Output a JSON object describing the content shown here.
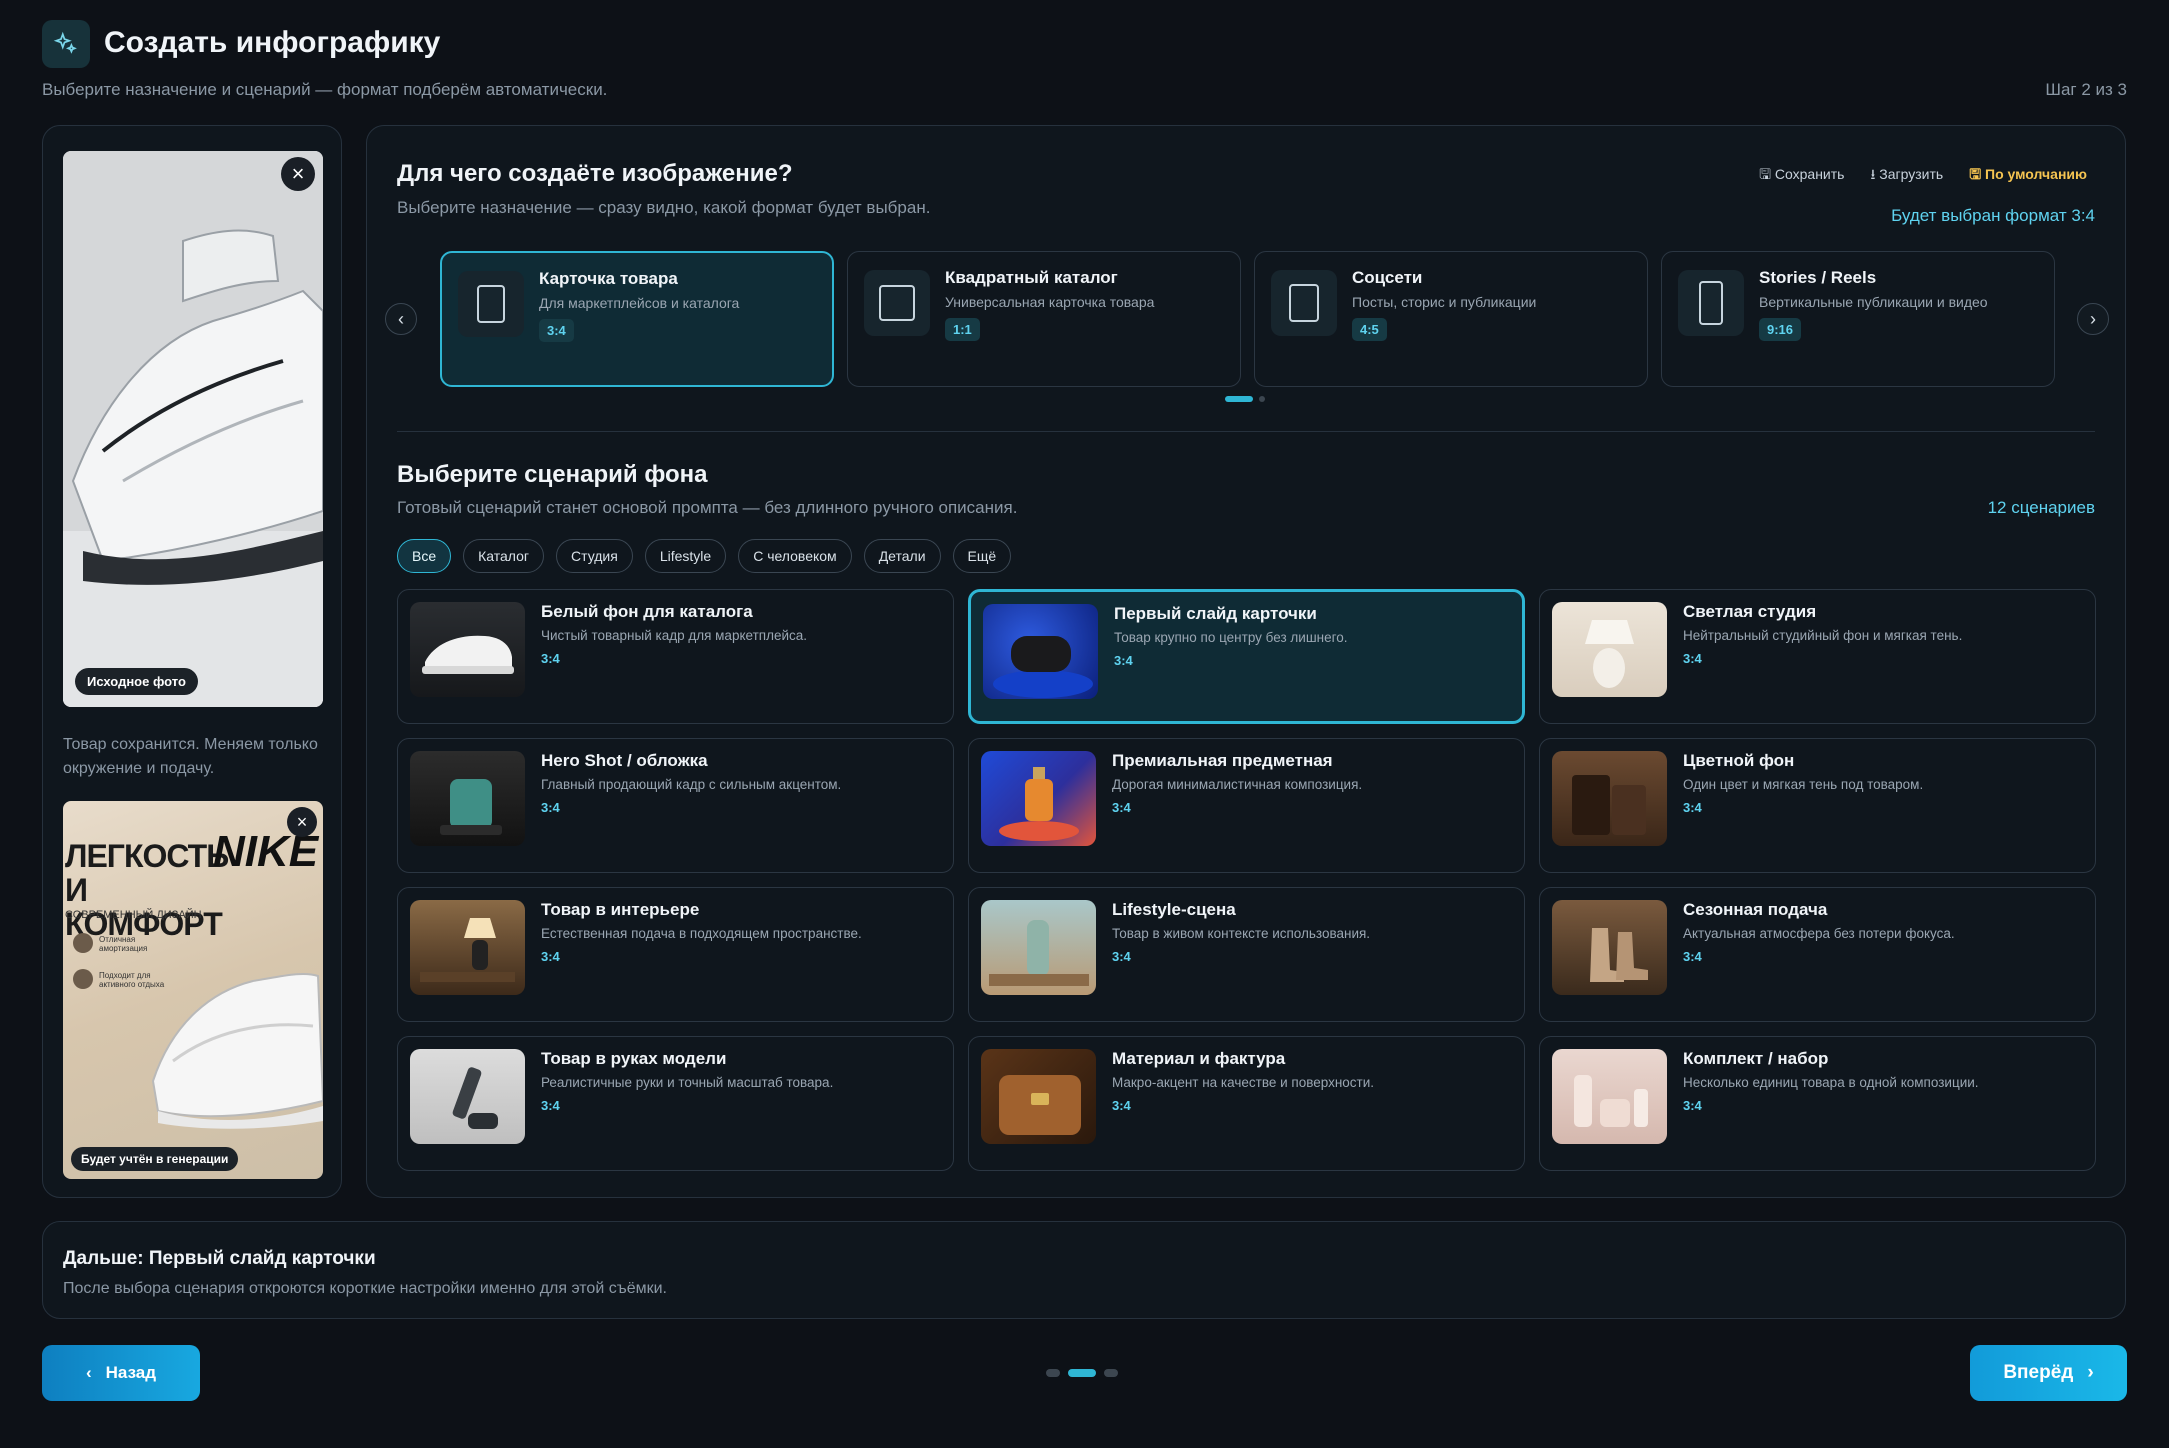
{
  "header": {
    "title": "Создать инфографику",
    "subtitle": "Выберите назначение и сценарий — формат подберём автоматически.",
    "step": "Шаг 2 из 3",
    "icon": "sparkles-icon"
  },
  "left": {
    "source_badge": "Исходное фото",
    "note": "Товар сохранится. Меняем только окружение и подачу.",
    "reference_badge": "Будет учтён в генерации",
    "reference_poster": {
      "headline": "ЛЕГКОСТЬ И КОМФОРТ",
      "tagline": "СОВРЕМЕННЫЙ ДИЗАЙН",
      "feature1": "Отличная амортизация",
      "feature2": "Подходит для активного отдыха",
      "brand": "NIKE"
    }
  },
  "purpose": {
    "title": "Для чего создаёте изображение?",
    "subtitle": "Выберите назначение — сразу видно, какой формат будет выбран.",
    "save_label": "Сохранить",
    "upload_label": "Загрузить",
    "default_label": "По умолчанию",
    "format_note": "Будет выбран формат 3:4",
    "formats": [
      {
        "title": "Карточка товара",
        "desc": "Для маркетплейсов и каталога",
        "ratio": "3:4"
      },
      {
        "title": "Квадратный каталог",
        "desc": "Универсальная карточка товара",
        "ratio": "1:1"
      },
      {
        "title": "Соцсети",
        "desc": "Посты, сторис и публикации",
        "ratio": "4:5"
      },
      {
        "title": "Stories / Reels",
        "desc": "Вертикальные публикации и видео",
        "ratio": "9:16"
      }
    ]
  },
  "scenario": {
    "title": "Выберите сценарий фона",
    "subtitle": "Готовый сценарий станет основой промпта — без длинного ручного описания.",
    "count": "12 сценариев",
    "filters": [
      "Все",
      "Каталог",
      "Студия",
      "Lifestyle",
      "С человеком",
      "Детали",
      "Ещё"
    ],
    "items": [
      {
        "title": "Белый фон для каталога",
        "desc": "Чистый товарный кадр для маркетплейса.",
        "ratio": "3:4"
      },
      {
        "title": "Первый слайд карточки",
        "desc": "Товар крупно по центру без лишнего.",
        "ratio": "3:4"
      },
      {
        "title": "Светлая студия",
        "desc": "Нейтральный студийный фон и мягкая тень.",
        "ratio": "3:4"
      },
      {
        "title": "Hero Shot / обложка",
        "desc": "Главный продающий кадр с сильным акцентом.",
        "ratio": "3:4"
      },
      {
        "title": "Премиальная предметная",
        "desc": "Дорогая минималистичная композиция.",
        "ratio": "3:4"
      },
      {
        "title": "Цветной фон",
        "desc": "Один цвет и мягкая тень под товаром.",
        "ratio": "3:4"
      },
      {
        "title": "Товар в интерьере",
        "desc": "Естественная подача в подходящем пространстве.",
        "ratio": "3:4"
      },
      {
        "title": "Lifestyle-сцена",
        "desc": "Товар в живом контексте использования.",
        "ratio": "3:4"
      },
      {
        "title": "Сезонная подача",
        "desc": "Актуальная атмосфера без потери фокуса.",
        "ratio": "3:4"
      },
      {
        "title": "Товар в руках модели",
        "desc": "Реалистичные руки и точный масштаб товара.",
        "ratio": "3:4"
      },
      {
        "title": "Материал и фактура",
        "desc": "Макро-акцент на качестве и поверхности.",
        "ratio": "3:4"
      },
      {
        "title": "Комплект / набор",
        "desc": "Несколько единиц товара в одной композиции.",
        "ratio": "3:4"
      }
    ]
  },
  "next": {
    "title": "Дальше: Первый слайд карточки",
    "desc": "После выбора сценария откроются короткие настройки именно для этой съёмки."
  },
  "footer": {
    "back_label": "Назад",
    "forward_label": "Вперёд"
  },
  "colors": {
    "accent": "#2fb6d4",
    "background": "#0d1117"
  }
}
